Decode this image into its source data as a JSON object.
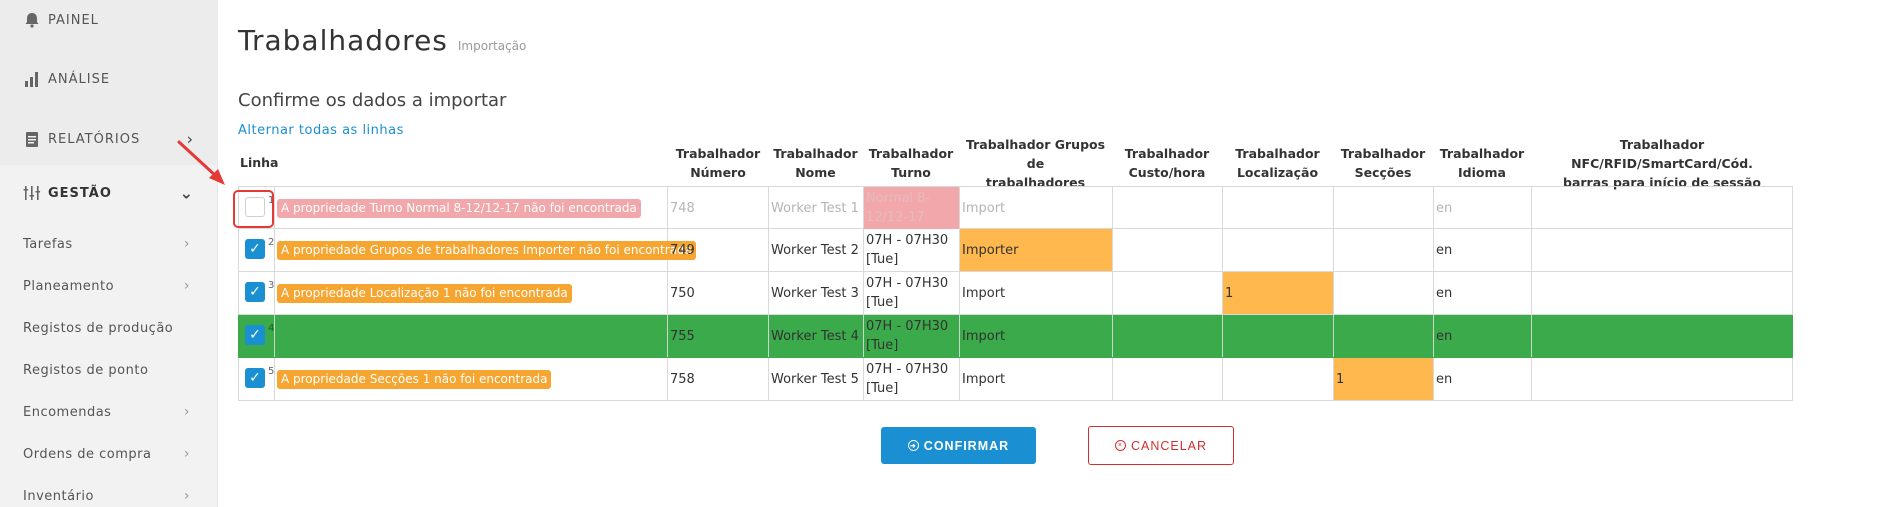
{
  "sidebar": {
    "top_items": [
      {
        "label": "PAINEL",
        "icon": "bell-icon"
      },
      {
        "label": "ANÁLISE",
        "icon": "bar-chart-icon"
      },
      {
        "label": "RELATÓRIOS",
        "icon": "report-icon"
      }
    ],
    "group": {
      "label": "GESTÃO",
      "icon": "gestao-icon"
    },
    "sub_items": [
      {
        "label": "Tarefas",
        "has_chevron": true
      },
      {
        "label": "Planeamento",
        "has_chevron": true
      },
      {
        "label": "Registos de produção",
        "has_chevron": false
      },
      {
        "label": "Registos de ponto",
        "has_chevron": false
      },
      {
        "label": "Encomendas",
        "has_chevron": true
      },
      {
        "label": "Ordens de compra",
        "has_chevron": true
      },
      {
        "label": "Inventário",
        "has_chevron": true
      }
    ]
  },
  "page": {
    "title": "Trabalhadores",
    "subtitle": "Importação",
    "section_heading": "Confirme os dados a importar",
    "toggle_all_link": "Alternar todas as linhas"
  },
  "table": {
    "linha_header": "Linha",
    "headers": [
      {
        "line1": "Trabalhador",
        "line2": "Número"
      },
      {
        "line1": "Trabalhador",
        "line2": "Nome"
      },
      {
        "line1": "Trabalhador",
        "line2": "Turno"
      },
      {
        "line1": "Trabalhador Grupos de",
        "line2": "trabalhadores"
      },
      {
        "line1": "Trabalhador",
        "line2": "Custo/hora"
      },
      {
        "line1": "Trabalhador",
        "line2": "Localização"
      },
      {
        "line1": "Trabalhador",
        "line2": "Secções"
      },
      {
        "line1": "Trabalhador",
        "line2": "Idioma"
      },
      {
        "line1": "Trabalhador NFC/RFID/SmartCard/Cód.",
        "line2": "barras para início de sessão"
      }
    ],
    "rows": [
      {
        "num": "1",
        "checked": false,
        "message": "A propriedade Turno Normal 8-12/12-17 não foi encontrada",
        "numero": "748",
        "nome": "Worker Test 1",
        "turno_l1": "Normal 8-",
        "turno_l2": "12/12-17",
        "grupo": "Import",
        "custo": "",
        "localizacao": "",
        "seccoes": "",
        "idioma": "en",
        "nfc": ""
      },
      {
        "num": "2",
        "checked": true,
        "message": "A propriedade Grupos de trabalhadores Importer não foi encontrada",
        "numero": "749",
        "nome": "Worker Test 2",
        "turno_l1": "07H - 07H30",
        "turno_l2": "[Tue]",
        "grupo": "Importer",
        "custo": "",
        "localizacao": "",
        "seccoes": "",
        "idioma": "en",
        "nfc": ""
      },
      {
        "num": "3",
        "checked": true,
        "message": "A propriedade Localização 1 não foi encontrada",
        "numero": "750",
        "nome": "Worker Test 3",
        "turno_l1": "07H - 07H30",
        "turno_l2": "[Tue]",
        "grupo": "Import",
        "custo": "",
        "localizacao": "1",
        "seccoes": "",
        "idioma": "en",
        "nfc": ""
      },
      {
        "num": "4",
        "checked": true,
        "message": "",
        "numero": "755",
        "nome": "Worker Test 4",
        "turno_l1": "07H - 07H30",
        "turno_l2": "[Tue]",
        "grupo": "Import",
        "custo": "",
        "localizacao": "",
        "seccoes": "",
        "idioma": "en",
        "nfc": ""
      },
      {
        "num": "5",
        "checked": true,
        "message": "A propriedade Secções 1 não foi encontrada",
        "numero": "758",
        "nome": "Worker Test 5",
        "turno_l1": "07H - 07H30",
        "turno_l2": "[Tue]",
        "grupo": "Import",
        "custo": "",
        "localizacao": "",
        "seccoes": "1",
        "idioma": "en",
        "nfc": ""
      }
    ]
  },
  "actions": {
    "confirm_label": "CONFIRMAR",
    "cancel_label": "CANCELAR"
  },
  "colors": {
    "accent_blue": "#1a8fd1",
    "error_pink": "#f2a7ab",
    "warning_orange": "#f6a530",
    "cell_orange": "#ffb84d",
    "valid_green": "#3aaa4a",
    "cancel_red": "#d32f2f",
    "annotation_red": "#e53935"
  }
}
